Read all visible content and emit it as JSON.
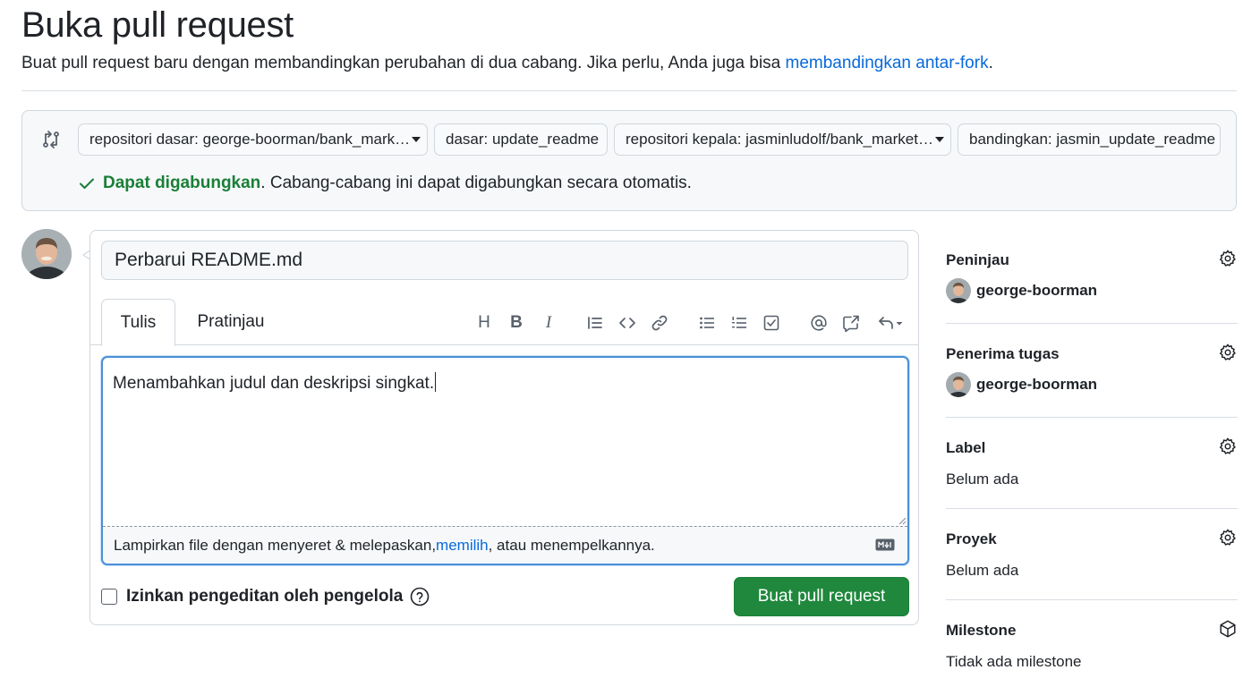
{
  "header": {
    "title": "Buka pull request",
    "subtitle_prefix": "Buat pull request baru dengan membandingkan perubahan di dua cabang. Jika perlu, Anda juga bisa ",
    "subtitle_link": "membandingkan antar-fork",
    "subtitle_suffix": "."
  },
  "compare": {
    "base_repo": "repositori dasar: george-boorman/bank_mark…",
    "base_branch": "dasar: update_readme",
    "head_repo": "repositori kepala: jasminludolf/bank_market…",
    "compare_branch": "bandingkan: jasmin_update_readme",
    "merge_ok": "Dapat digabungkan",
    "merge_text": ". Cabang-cabang ini dapat digabungkan secara otomatis."
  },
  "composer": {
    "title_value": "Perbarui README.md",
    "tabs": {
      "write": "Tulis",
      "preview": "Pratinjau"
    },
    "toolbar": {
      "heading": "H",
      "bold": "B",
      "italic": "I"
    },
    "body_text": "Menambahkan judul dan deskripsi singkat.",
    "attach_prefix": "Lampirkan file dengan menyeret & melepaskan, ",
    "attach_link": "memilih",
    "attach_suffix": ", atau menempelkannya.",
    "allow_edits": "Izinkan pengeditan oleh pengelola",
    "submit": "Buat pull request"
  },
  "sidebar": {
    "reviewers": {
      "label": "Peninjau",
      "value": "george-boorman"
    },
    "assignees": {
      "label": "Penerima tugas",
      "value": "george-boorman"
    },
    "labels": {
      "label": "Label",
      "value": "Belum ada"
    },
    "projects": {
      "label": "Proyek",
      "value": "Belum ada"
    },
    "milestone": {
      "label": "Milestone",
      "value": "Tidak ada milestone"
    }
  },
  "colors": {
    "accent_link": "#0969da",
    "success": "#1a7f37",
    "primary_button": "#1f883d",
    "focus_border": "#4a90d9"
  },
  "icons": [
    "git-compare-icon",
    "check-icon",
    "caret-down-icon",
    "heading-icon",
    "bold-icon",
    "italic-icon",
    "quote-icon",
    "code-icon",
    "link-icon",
    "bullet-list-icon",
    "numbered-list-icon",
    "task-list-icon",
    "mention-icon",
    "reference-icon",
    "undo-icon",
    "markdown-icon",
    "help-icon",
    "gear-icon",
    "milestone-icon"
  ]
}
